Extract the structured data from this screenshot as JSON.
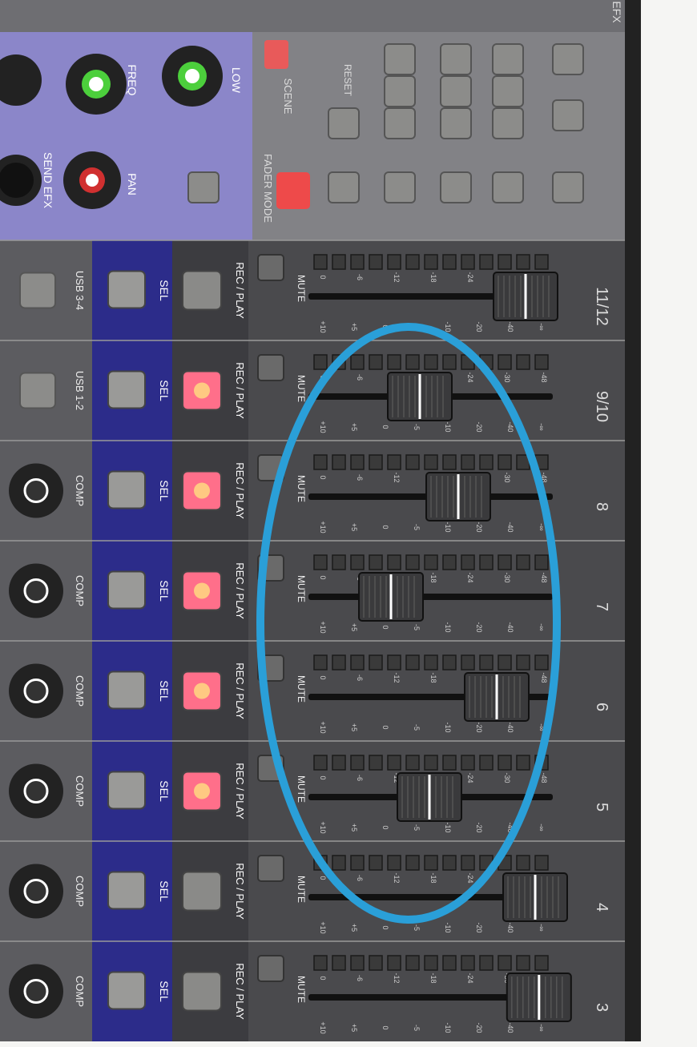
{
  "photo": {
    "rotation_deg": 90,
    "colors": {
      "panel_grey": "#6e6e72",
      "panel_dark": "#3a3a3e",
      "panel_purple": "#8b86c9",
      "sel_strip": "#2c2c8a",
      "fader_area": "#4a4a4d",
      "led_lit": "#ff6f8a",
      "button_grey": "#8c8c8a",
      "annotation_ellipse": "#2a9fd8",
      "knob_green": "#4ccf3c",
      "knob_red": "#d03030"
    }
  },
  "top_section": {
    "knob_labels": [
      "SEND EFX",
      "FREQ",
      "PAN",
      "LOW"
    ],
    "scene_label": "SCENE",
    "reset_label": "RESET",
    "fader_mode_label": "FADER MODE",
    "efx_label": "EFX"
  },
  "channels": [
    {
      "number": "11/12",
      "mute": "MUTE",
      "top_label": "USB 3-4",
      "sel": "SEL",
      "rec": "REC / PLAY",
      "rec_lit": false,
      "fader_level": 0.9
    },
    {
      "number": "9/10",
      "mute": "MUTE",
      "top_label": "USB 1-2",
      "sel": "SEL",
      "rec": "REC / PLAY",
      "rec_lit": true,
      "fader_level": 0.35
    },
    {
      "number": "8",
      "mute": "MUTE",
      "top_label": "COMP",
      "sel": "SEL",
      "rec": "REC / PLAY",
      "rec_lit": true,
      "fader_level": 0.55
    },
    {
      "number": "7",
      "mute": "MUTE",
      "top_label": "COMP",
      "sel": "SEL",
      "rec": "REC / PLAY",
      "rec_lit": true,
      "fader_level": 0.2
    },
    {
      "number": "6",
      "mute": "MUTE",
      "top_label": "COMP",
      "sel": "SEL",
      "rec": "REC / PLAY",
      "rec_lit": true,
      "fader_level": 0.75
    },
    {
      "number": "5",
      "mute": "MUTE",
      "top_label": "COMP",
      "sel": "SEL",
      "rec": "REC / PLAY",
      "rec_lit": true,
      "fader_level": 0.4
    },
    {
      "number": "4",
      "mute": "MUTE",
      "top_label": "COMP",
      "sel": "SEL",
      "rec": "REC / PLAY",
      "rec_lit": false,
      "fader_level": 0.95
    },
    {
      "number": "3",
      "mute": "MUTE",
      "top_label": "COMP",
      "sel": "SEL",
      "rec": "REC / PLAY",
      "rec_lit": false,
      "fader_level": 0.97
    }
  ],
  "meter_scale": [
    "0",
    "-6",
    "-12",
    "-18",
    "-24",
    "-30",
    "-48"
  ],
  "fader_scale": [
    "+10",
    "+5",
    "0",
    "-5",
    "-10",
    "-20",
    "-40",
    "-∞"
  ]
}
